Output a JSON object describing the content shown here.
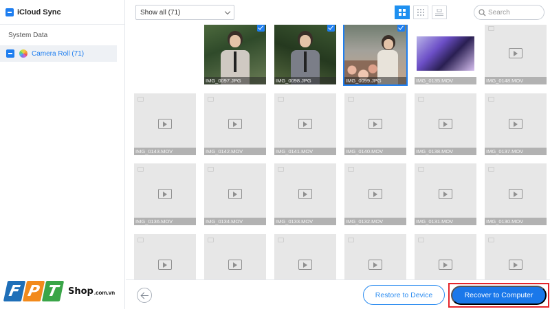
{
  "sidebar": {
    "title": "iCloud Sync",
    "section_label": "System Data",
    "items": [
      {
        "label": "Camera Roll (71)",
        "icon": "photos-app-icon",
        "selected": true
      }
    ]
  },
  "toolbar": {
    "filter_value": "Show all (71)",
    "search_placeholder": "Search",
    "views": [
      "grid-large-view-icon",
      "grid-small-view-icon",
      "list-view-icon"
    ],
    "active_view": "grid-large-view-icon"
  },
  "grid": {
    "tiles": [
      {
        "caption": "",
        "kind": "empty"
      },
      {
        "caption": "IMG_0097.JPG",
        "kind": "photo",
        "checked": true
      },
      {
        "caption": "IMG_0098.JPG",
        "kind": "photo",
        "checked": true
      },
      {
        "caption": "IMG_0099.JPG",
        "kind": "photo",
        "checked": true,
        "selected": true
      },
      {
        "caption": "IMG_0135.MOV",
        "kind": "video-thumb"
      },
      {
        "caption": "IMG_0148.MOV",
        "kind": "video"
      },
      {
        "caption": "IMG_0143.MOV",
        "kind": "video"
      },
      {
        "caption": "IMG_0142.MOV",
        "kind": "video"
      },
      {
        "caption": "IMG_0141.MOV",
        "kind": "video"
      },
      {
        "caption": "IMG_0140.MOV",
        "kind": "video"
      },
      {
        "caption": "IMG_0138.MOV",
        "kind": "video"
      },
      {
        "caption": "IMG_0137.MOV",
        "kind": "video"
      },
      {
        "caption": "IMG_0136.MOV",
        "kind": "video"
      },
      {
        "caption": "IMG_0134.MOV",
        "kind": "video"
      },
      {
        "caption": "IMG_0133.MOV",
        "kind": "video"
      },
      {
        "caption": "IMG_0132.MOV",
        "kind": "video"
      },
      {
        "caption": "IMG_0131.MOV",
        "kind": "video"
      },
      {
        "caption": "IMG_0130.MOV",
        "kind": "video"
      },
      {
        "caption": "",
        "kind": "video"
      },
      {
        "caption": "",
        "kind": "video"
      },
      {
        "caption": "",
        "kind": "video"
      },
      {
        "caption": "",
        "kind": "video"
      },
      {
        "caption": "",
        "kind": "video"
      },
      {
        "caption": "",
        "kind": "video"
      }
    ]
  },
  "footer": {
    "back_icon": "back-arrow-icon",
    "restore_label": "Restore to Device",
    "recover_label": "Recover to Computer"
  },
  "brand": {
    "letters": [
      "F",
      "P",
      "T"
    ],
    "shop": "Shop",
    "domain": ".com.vn"
  },
  "colors": {
    "accent": "#1e7ef0",
    "highlight": "#e4242a"
  }
}
